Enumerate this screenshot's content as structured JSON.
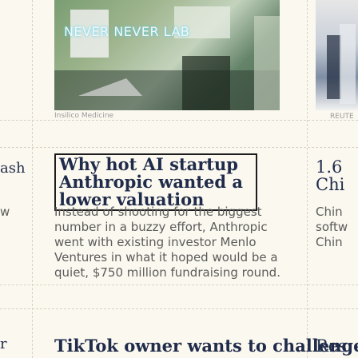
{
  "cards": {
    "left": {
      "title": "ash",
      "body": "w",
      "next": "r"
    },
    "main": {
      "image_caption": "Insilico Medicine",
      "sign_text": "NEVER NEVER LAB",
      "title": "Why hot AI startup Anthropic wanted a lower valuation",
      "body": "Instead of shooting for the biggest number in a buzzy effort, Anthropic went with existing investor Menlo Ventures in what it hoped would be a quiet, $750 million fundraising round.",
      "next_title": "TikTok owner wants to challenge"
    },
    "right": {
      "image_caption": "REUTE",
      "title": "1.6 Chi",
      "body": "Chin softw Chin",
      "next_title": "Res"
    }
  }
}
